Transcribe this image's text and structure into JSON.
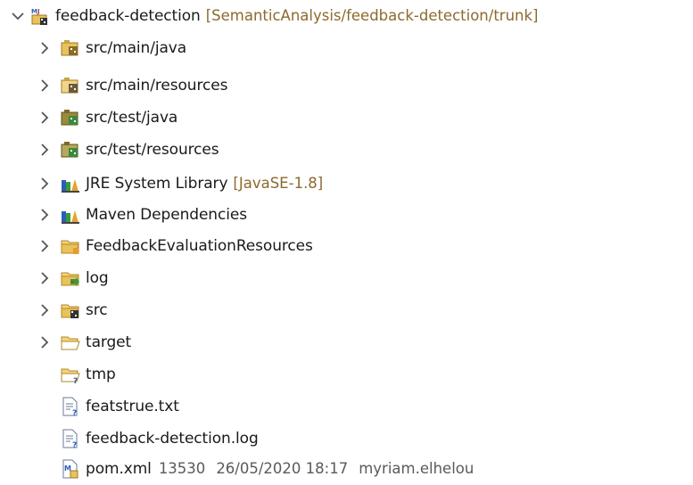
{
  "project": {
    "name": "feedback-detection",
    "location": "[SemanticAnalysis/feedback-detection/trunk]"
  },
  "items": [
    {
      "label": "src/main/java",
      "icon": "package-folder-icon",
      "expandable": true
    },
    {
      "label": "src/main/resources",
      "icon": "resource-folder-icon",
      "expandable": true
    },
    {
      "label": "src/test/java",
      "icon": "test-package-folder-icon",
      "expandable": true
    },
    {
      "label": "src/test/resources",
      "icon": "test-resource-folder-icon",
      "expandable": true
    },
    {
      "label": "JRE System Library",
      "decoration": "[JavaSE-1.8]",
      "icon": "library-icon",
      "expandable": true
    },
    {
      "label": "Maven Dependencies",
      "icon": "library-icon",
      "expandable": true
    },
    {
      "label": "FeedbackEvaluationResources",
      "icon": "folder-icon",
      "expandable": true
    },
    {
      "label": "log",
      "icon": "log-folder-icon",
      "expandable": true
    },
    {
      "label": "src",
      "icon": "source-folder-icon",
      "expandable": true
    },
    {
      "label": "target",
      "icon": "open-folder-icon",
      "expandable": true
    },
    {
      "label": "tmp",
      "icon": "unversioned-folder-icon",
      "expandable": false
    },
    {
      "label": "featstrue.txt",
      "icon": "text-file-icon",
      "expandable": false
    },
    {
      "label": "feedback-detection.log",
      "icon": "text-file-icon",
      "expandable": false
    },
    {
      "label": "pom.xml",
      "icon": "maven-pom-icon",
      "expandable": false,
      "meta": {
        "revision": "13530",
        "date": "26/05/2020 18:17",
        "author": "myriam.elhelou"
      }
    }
  ],
  "colors": {
    "folder_yellow": "#e8c25a",
    "package_brown": "#8b6a2a",
    "decoration_text": "#8c6a2e",
    "chevron": "#555555"
  }
}
